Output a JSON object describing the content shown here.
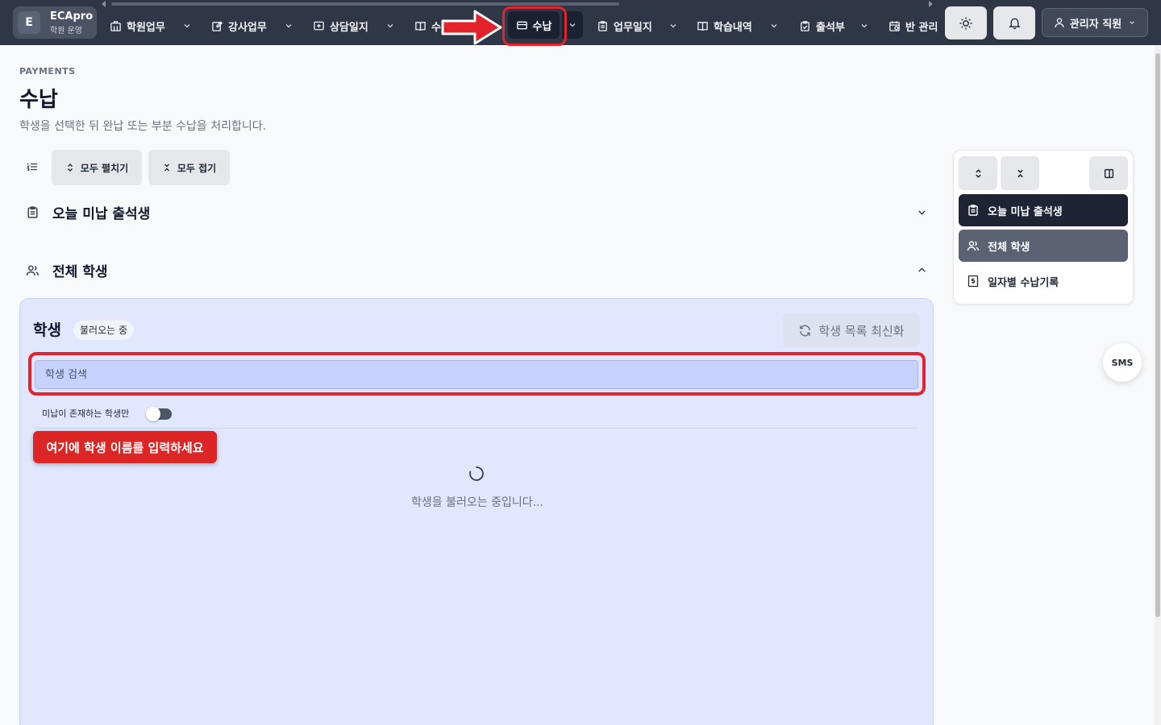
{
  "brand": {
    "logo_letter": "E",
    "name": "ECApro",
    "subtitle": "학원 운영"
  },
  "nav": {
    "items": [
      {
        "label": "학원업무",
        "icon": "building-icon"
      },
      {
        "label": "강사업무",
        "icon": "edit-icon"
      },
      {
        "label": "상담일지",
        "icon": "message-plus-icon"
      },
      {
        "label": "수",
        "icon": "book-icon"
      },
      {
        "label": "수납",
        "icon": "credit-card-icon",
        "active": true
      },
      {
        "label": "업무일지",
        "icon": "clipboard-icon"
      },
      {
        "label": "학습내역",
        "icon": "book-open-icon"
      },
      {
        "label": "출석부",
        "icon": "clipboard-check-icon"
      },
      {
        "label": "반 관리",
        "icon": "calendar-icon"
      }
    ]
  },
  "top_actions": {
    "admin_label": "관리자 직원"
  },
  "page": {
    "eyebrow": "PAYMENTS",
    "title": "수납",
    "description": "학생을 선택한 뒤 완납 또는 부분 수납을 처리합니다.",
    "expand_all": "모두 펼치기",
    "collapse_all": "모두 접기"
  },
  "sections": {
    "unpaid_today": "오늘 미납 출석생",
    "all_students": "전체 학생"
  },
  "student_panel": {
    "title": "학생",
    "status_badge": "불러오는 중",
    "refresh_label": "학생 목록 최신화",
    "search_placeholder": "학생 검색",
    "filter_label": "미납이 존재하는 학생만",
    "filter_enabled": false,
    "loading_text": "학생을 불러오는 중입니다..."
  },
  "tooltip": {
    "text": "여기에 학생 이름를 입력하세요"
  },
  "toc": {
    "items": [
      {
        "label": "오늘 미납 출석생",
        "state": "active"
      },
      {
        "label": "전체 학생",
        "state": "hover"
      },
      {
        "label": "일자별 수납기록",
        "state": "default"
      }
    ]
  },
  "sms": {
    "label": "SMS"
  },
  "colors": {
    "topbar": "#2f3646",
    "highlight": "#e3232b",
    "panel": "#e0e7ff",
    "search": "#c7d2fe",
    "tooltip": "#dc2626"
  }
}
